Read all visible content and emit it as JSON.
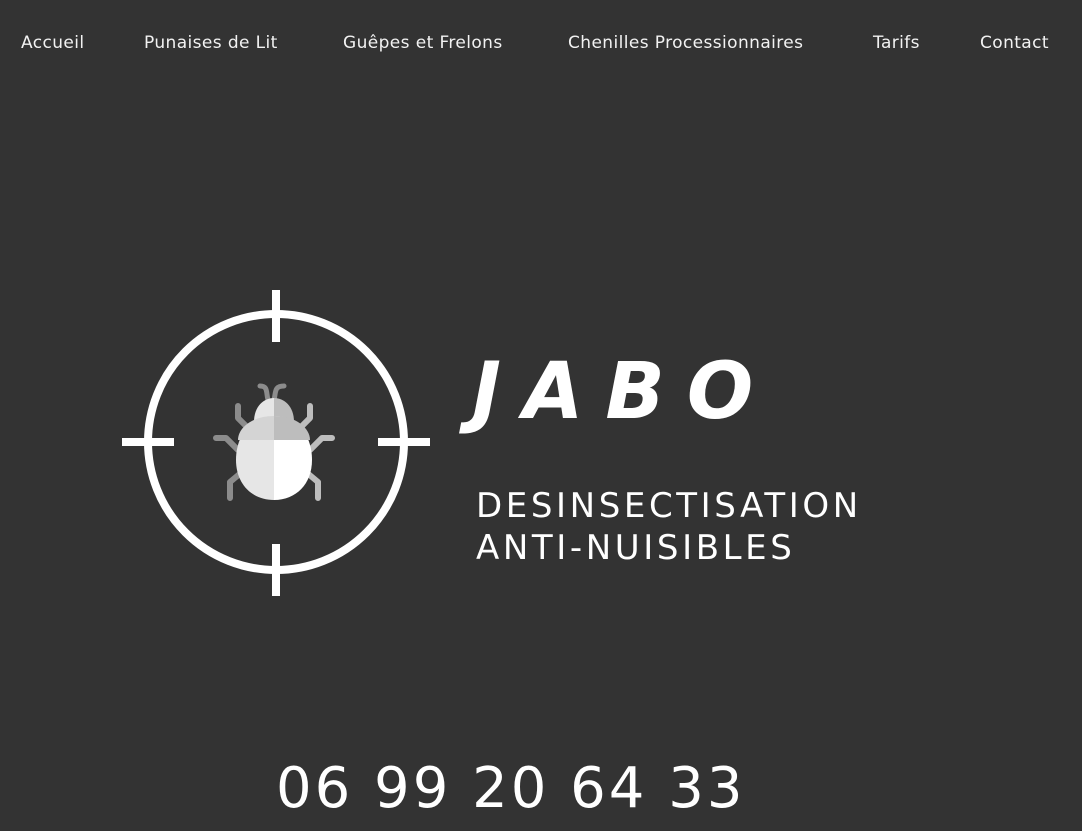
{
  "nav": {
    "items": [
      {
        "label": "Accueil"
      },
      {
        "label": "Punaises de Lit"
      },
      {
        "label": "Guêpes et Frelons"
      },
      {
        "label": "Chenilles Processionnaires"
      },
      {
        "label": "Tarifs"
      },
      {
        "label": "Contact"
      }
    ]
  },
  "brand": {
    "name": "JABO",
    "tagline_line1": "DESINSECTISATION",
    "tagline_line2": "ANTI-NUISIBLES",
    "logo_icon": "bug-in-crosshair-icon"
  },
  "contact": {
    "phone": "06 99 20 64 33"
  },
  "colors": {
    "background": "#333333",
    "text": "#ffffff",
    "bug_light": "#e6e6e6",
    "bug_dark": "#bdbdbd",
    "bug_legs": "#8c8c8c"
  }
}
